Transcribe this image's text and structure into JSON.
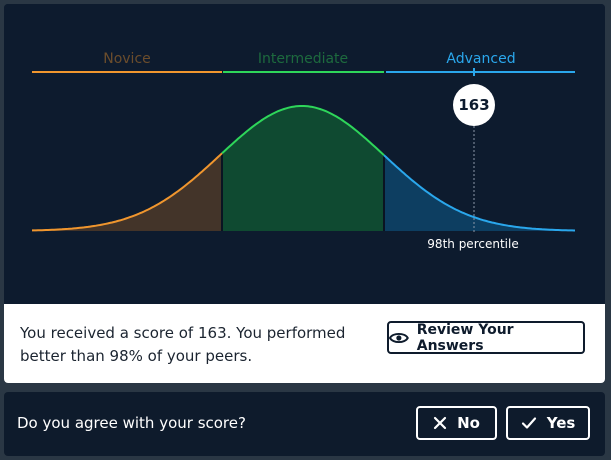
{
  "chart": {
    "levels": [
      {
        "label": "Novice",
        "color": "#f0962e",
        "fill": "#433429"
      },
      {
        "label": "Intermediate",
        "color": "#2ed65a",
        "fill": "#0f4a31"
      },
      {
        "label": "Advanced",
        "color": "#2aa7ec",
        "fill": "#0d3e61"
      }
    ],
    "score": "163",
    "percentile_label": "98th percentile",
    "marker_color": "#ffffff"
  },
  "result": {
    "text": "You received a score of 163. You performed better than 98% of your peers.",
    "review_label": "Review Your Answers"
  },
  "feedback": {
    "question": "Do you agree with your score?",
    "no_label": "No",
    "yes_label": "Yes"
  }
}
